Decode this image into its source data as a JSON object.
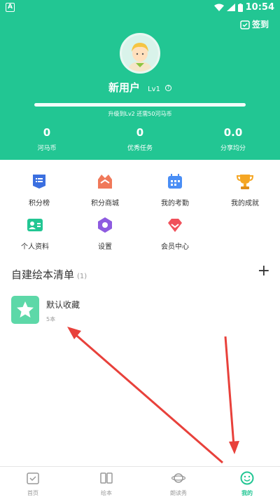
{
  "status_bar": {
    "time": "10:54",
    "app_badge": "A"
  },
  "header": {
    "checkin_label": "签到",
    "username": "新用户",
    "level": "Lv1",
    "progress": 0.0,
    "upgrade_text": "升级到Lv2 还需50河马币",
    "stats": [
      {
        "value": "0",
        "label": "河马币"
      },
      {
        "value": "0",
        "label": "优秀任务"
      },
      {
        "value": "0.0",
        "label": "分享均分"
      }
    ]
  },
  "menu": {
    "items": [
      {
        "label": "积分榜",
        "icon": "ranking-icon",
        "color": "#3b6fe0"
      },
      {
        "label": "积分商城",
        "icon": "mall-icon",
        "color": "#f0795a"
      },
      {
        "label": "我的考勤",
        "icon": "calendar-icon",
        "color": "#4a8ef5"
      },
      {
        "label": "我的成就",
        "icon": "trophy-icon",
        "color": "#f5a623"
      },
      {
        "label": "个人资料",
        "icon": "profile-card-icon",
        "color": "#22c693"
      },
      {
        "label": "设置",
        "icon": "settings-icon",
        "color": "#8e5be0"
      },
      {
        "label": "会员中心",
        "icon": "diamond-icon",
        "color": "#f0505a"
      }
    ]
  },
  "booklists": {
    "title": "自建绘本清单",
    "count": "(1)",
    "add_label": "+",
    "items": [
      {
        "name": "默认收藏",
        "count": "5本"
      }
    ]
  },
  "tabbar": {
    "tabs": [
      {
        "label": "首页",
        "icon": "home-icon",
        "active": false
      },
      {
        "label": "绘本",
        "icon": "book-icon",
        "active": false
      },
      {
        "label": "朗读秀",
        "icon": "planet-icon",
        "active": false
      },
      {
        "label": "我的",
        "icon": "smile-icon",
        "active": true
      }
    ]
  },
  "colors": {
    "brand": "#22c693",
    "annotation_arrow": "#e8413b"
  }
}
